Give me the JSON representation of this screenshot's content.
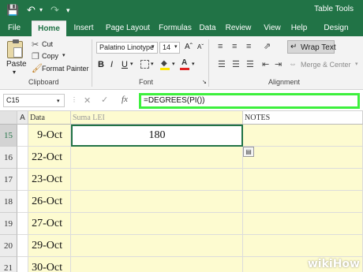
{
  "title_bar": {
    "context_label": "Table Tools"
  },
  "tabs": [
    "File",
    "Home",
    "Insert",
    "Page Layout",
    "Formulas",
    "Data",
    "Review",
    "View",
    "Help",
    "Design"
  ],
  "active_tab": "Home",
  "clipboard": {
    "paste": "Paste",
    "cut": "Cut",
    "copy": "Copy",
    "format_painter": "Format Painter",
    "group": "Clipboard"
  },
  "font": {
    "name": "Palatino Linotype",
    "size": "14",
    "bold": "B",
    "italic": "I",
    "underline": "U",
    "group": "Font"
  },
  "alignment": {
    "wrap_text": "Wrap Text",
    "merge_center": "Merge & Center",
    "group": "Alignment"
  },
  "formula_bar": {
    "name_box": "C15",
    "fx": "fx",
    "formula": "=DEGREES(PI())"
  },
  "columns": [
    "A",
    "Data",
    "Suma LEI",
    "NOTES"
  ],
  "rows": [
    {
      "num": "15",
      "date": "9-Oct",
      "value": "180"
    },
    {
      "num": "16",
      "date": "22-Oct",
      "value": ""
    },
    {
      "num": "17",
      "date": "23-Oct",
      "value": ""
    },
    {
      "num": "18",
      "date": "26-Oct",
      "value": ""
    },
    {
      "num": "19",
      "date": "27-Oct",
      "value": ""
    },
    {
      "num": "20",
      "date": "29-Oct",
      "value": ""
    },
    {
      "num": "21",
      "date": "30-Oct",
      "value": ""
    }
  ],
  "colors": {
    "excel_green": "#217346",
    "highlight_green": "#3df03d",
    "cell_yellow": "#fdfbd0"
  },
  "watermark": "wikiHow"
}
